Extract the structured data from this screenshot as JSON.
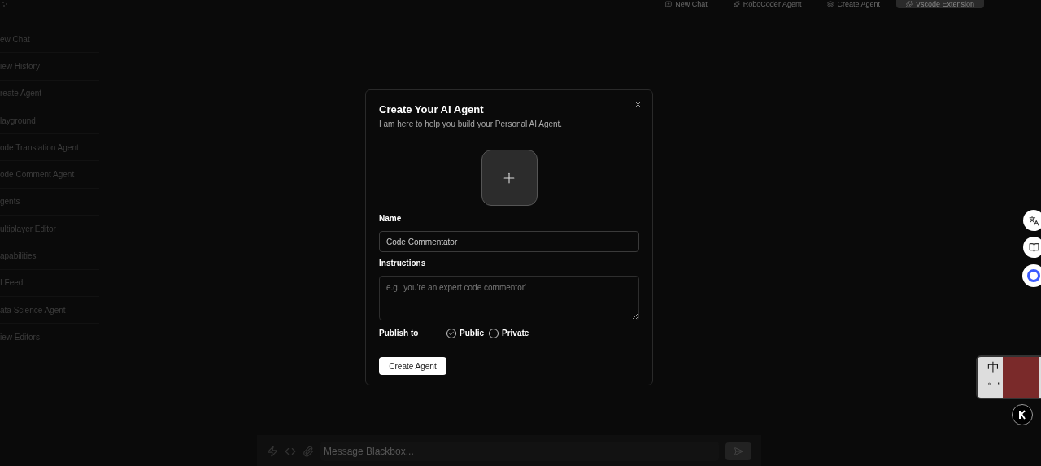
{
  "top_bar": {
    "items": [
      {
        "label": "New Chat",
        "selected": false
      },
      {
        "label": "RoboCoder Agent",
        "selected": false
      },
      {
        "label": "Create Agent",
        "selected": false
      },
      {
        "label": "Vscode Extension",
        "selected": true
      }
    ]
  },
  "sidebar": {
    "items": [
      {
        "label": "ew Chat"
      },
      {
        "label": "iew History"
      },
      {
        "label": "reate Agent"
      },
      {
        "label": "layground"
      },
      {
        "label": "ode Translation Agent"
      },
      {
        "label": "ode Comment Agent"
      },
      {
        "label": "gents"
      },
      {
        "label": "ultiplayer Editor"
      },
      {
        "label": "apabilities"
      },
      {
        "label": "I Feed"
      },
      {
        "label": "ata Science Agent"
      },
      {
        "label": "iew Editors"
      }
    ]
  },
  "dialog": {
    "title": "Create Your AI Agent",
    "subtitle": "I am here to help you build your Personal AI Agent.",
    "name_label": "Name",
    "name_value": "Code Commentator",
    "instructions_label": "Instructions",
    "instructions_placeholder": "e.g. 'you're an expert code commentor'",
    "publish_label": "Publish to",
    "options": [
      {
        "label": "Public",
        "selected": true
      },
      {
        "label": "Private",
        "selected": false
      }
    ],
    "submit": "Create Agent"
  },
  "composer": {
    "placeholder": "Message Blackbox..."
  },
  "ime_widget": {
    "char": "中",
    "punct": "。,"
  }
}
